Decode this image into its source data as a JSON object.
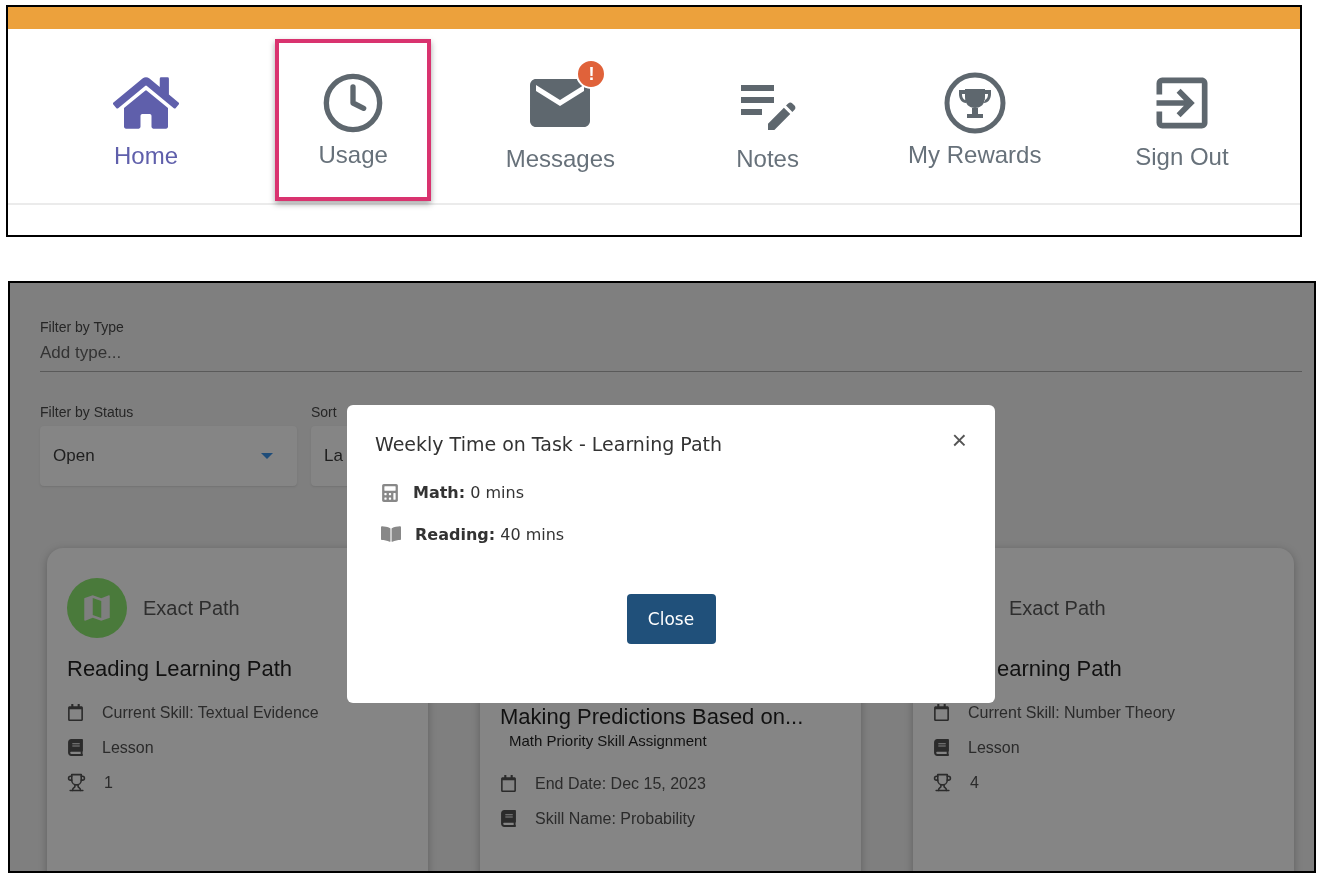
{
  "nav": {
    "items": [
      {
        "label": "Home",
        "active": true,
        "highlighted": false
      },
      {
        "label": "Usage",
        "active": false,
        "highlighted": true
      },
      {
        "label": "Messages",
        "active": false,
        "highlighted": false,
        "badge": "!"
      },
      {
        "label": "Notes",
        "active": false,
        "highlighted": false
      },
      {
        "label": "My Rewards",
        "active": false,
        "highlighted": false
      },
      {
        "label": "Sign Out",
        "active": false,
        "highlighted": false
      }
    ]
  },
  "filters": {
    "type": {
      "label": "Filter by Type",
      "placeholder": "Add type..."
    },
    "status": {
      "label": "Filter by Status",
      "value": "Open"
    },
    "sort": {
      "label": "Sort",
      "value": "La"
    }
  },
  "cards": [
    {
      "provider": "Exact Path",
      "title": "Reading Learning Path",
      "rows": [
        {
          "kind": "date",
          "text": "Current Skill: Textual Evidence"
        },
        {
          "kind": "lesson",
          "text": "Lesson"
        },
        {
          "kind": "trophy",
          "text": "1"
        }
      ]
    },
    {
      "title": "Making Predictions Based on...",
      "subtitle": "Math Priority Skill Assignment",
      "rows": [
        {
          "kind": "date",
          "text": "End Date: Dec 15, 2023"
        },
        {
          "kind": "lesson",
          "text": "Skill Name: Probability"
        }
      ]
    },
    {
      "provider": "Exact Path",
      "title": "earning Path",
      "rows": [
        {
          "kind": "date",
          "text": "Current Skill: Number Theory"
        },
        {
          "kind": "lesson",
          "text": "Lesson"
        },
        {
          "kind": "trophy",
          "text": "4"
        }
      ]
    }
  ],
  "dialog": {
    "title": "Weekly Time on Task - Learning Path",
    "close": "×",
    "rows": [
      {
        "kind": "math",
        "text": "**Math:** 0 mins"
      },
      {
        "kind": "reading",
        "text": "**Reading:** 40 mins"
      }
    ],
    "button": "Close"
  }
}
